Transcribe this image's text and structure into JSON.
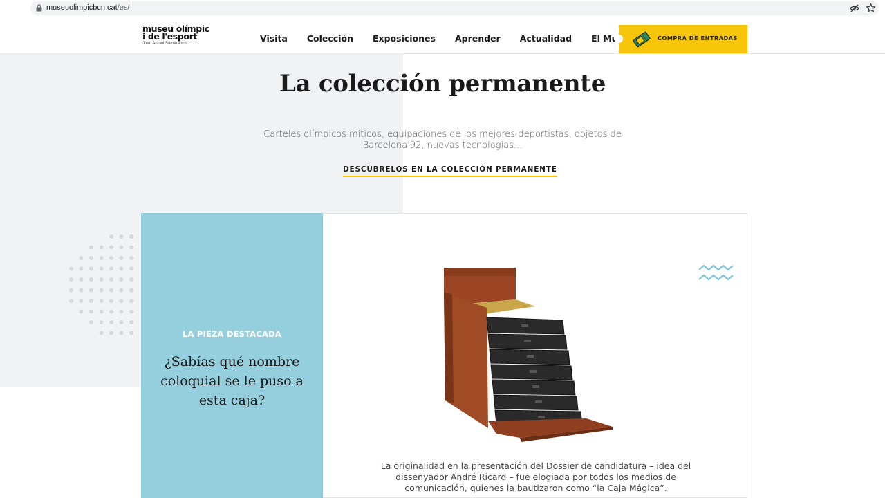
{
  "browser": {
    "url_domain": "museuolimpicbcn.cat",
    "url_path": "/es/"
  },
  "header": {
    "logo_line1": "museu olímpic",
    "logo_line2": "i de l'esport",
    "logo_sub": "Joan Antoni Samaranch",
    "nav": [
      "Visita",
      "Colección",
      "Exposiciones",
      "Aprender",
      "Actualidad",
      "El Museo"
    ],
    "tickets_label": "COMPRA DE ENTRADAS"
  },
  "hero": {
    "title": "La colección permanente",
    "description": "Carteles olímpicos míticos, equipaciones de los mejores deportistas, objetos de Barcelona'92, nuevas tecnologías...",
    "link": "DESCÚBRELOS EN LA COLECCIÓN PERMANENTE"
  },
  "feature": {
    "label": "LA PIEZA DESTACADA",
    "question": "¿Sabías qué nombre coloquial se le puso a esta caja?",
    "text": "La originalidad en la presentación del Dossier de candidatura – idea del dissenyador André Ricard –  fue elogiada por todos los medios de comunicación, quienes la bautizaron como “la Caja Mágica”."
  },
  "colors": {
    "accent_yellow": "#f7c50a",
    "panel_blue": "#95cedd",
    "panel_grey": "#f1f2f3",
    "wave_blue": "#7cc4d9"
  },
  "icons": [
    "lock-icon",
    "eye-off-icon",
    "star-icon",
    "ticket-icon",
    "wave-icon"
  ]
}
